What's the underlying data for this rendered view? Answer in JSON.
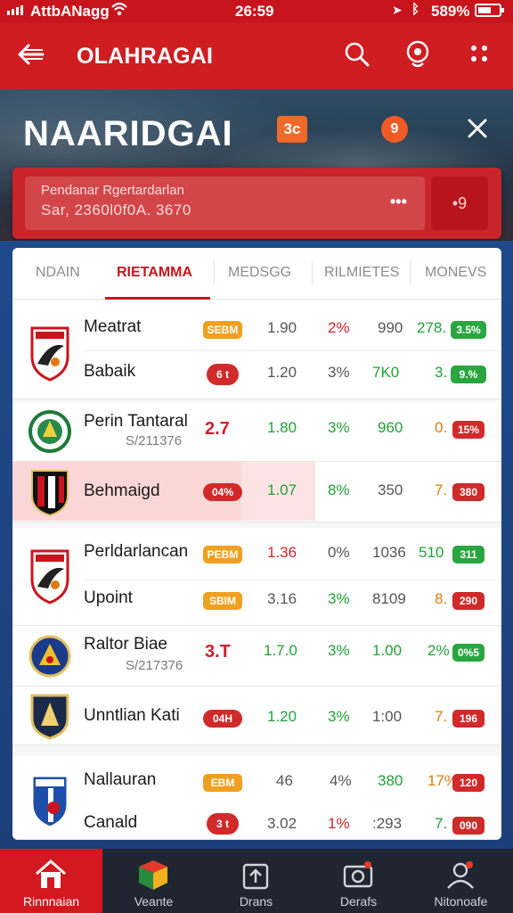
{
  "status": {
    "carrier": "AttbANagg",
    "time": "26:59",
    "battery": "589%"
  },
  "app_bar": {
    "title": "OLAHRAGAI",
    "icons": [
      "back-arrow-icon",
      "search-icon",
      "location-pin-icon",
      "more-dots-icon"
    ]
  },
  "hero": {
    "title": "NAARIDGAI",
    "badge": "3c",
    "round_badge": "9",
    "info_label": "Pendanar Rgertardarlan",
    "info_value": "Sar, 2360l0f0A. 3670",
    "dots": "•••",
    "side_value": "•9"
  },
  "tabs": [
    "NDAIN",
    "RIETAMMA",
    "MEDSGG",
    "RILMIETES",
    "MONEVS"
  ],
  "active_tab": 1,
  "colors": {
    "brand_red": "#cf1d22",
    "up_green": "#21a038",
    "down_red": "#d0202a",
    "pill_orange": "#f0a020"
  },
  "rows": [
    {
      "name": "Meatrat",
      "pill": "SEBM",
      "pill_color": "orange",
      "c1": "1.90",
      "c2": "2%",
      "c2_color": "red",
      "c3": "990",
      "c3_color": "plain",
      "c4": "278.",
      "c4_color": "green",
      "c5": "3.5%",
      "c5_color": "green"
    },
    {
      "name": "Babaik",
      "pill": "6 t",
      "pill_color": "red",
      "c1": "1.20",
      "c2": "3%",
      "c2_color": "plain",
      "c3": "7K0",
      "c3_color": "green",
      "c4": "3.",
      "c4_color": "green",
      "c5": "9.%",
      "c5_color": "green"
    },
    {
      "name": "Perin Tantaral",
      "sub": "S/211376",
      "pill": "2.7",
      "pill_color": "red",
      "c1": "1.80",
      "c1_color": "green",
      "c2": "3%",
      "c2_color": "green",
      "c3": "960",
      "c3_color": "green",
      "c4": "0.",
      "c4_color": "orange",
      "c5": "15%",
      "c5_color": "red"
    },
    {
      "name": "Behmaigd",
      "pill": "04%",
      "pill_color": "red",
      "c1": "1.07",
      "c1_color": "green",
      "c2": "8%",
      "c2_color": "green",
      "c3": "350",
      "c3_color": "plain",
      "c4": "7.",
      "c4_color": "orange",
      "c5": "380",
      "c5_color": "red"
    },
    {
      "name": "Perldarlancan",
      "pill": "PEBM",
      "pill_color": "orange",
      "c1": "1.36",
      "c1_color": "red",
      "c2": "0%",
      "c2_color": "plain",
      "c3": "1036",
      "c3_color": "plain",
      "c4": "510",
      "c4_color": "green",
      "c5": "311",
      "c5_color": "green"
    },
    {
      "name": "Upoint",
      "pill": "SBIM",
      "pill_color": "orange",
      "c1": "3.16",
      "c2": "3%",
      "c2_color": "green",
      "c3": "8109",
      "c3_color": "plain",
      "c4": "8.",
      "c4_color": "orange",
      "c5": "290",
      "c5_color": "red"
    },
    {
      "name": "Raltor Biae",
      "sub": "S/217376",
      "pill": "3.T",
      "pill_color": "red",
      "c1": "1.7.0",
      "c1_color": "green",
      "c2": "3%",
      "c2_color": "green",
      "c3": "1.00",
      "c3_color": "green",
      "c4": "2%",
      "c4_color": "green",
      "c5": "0%5",
      "c5_color": "green"
    },
    {
      "name": "Unntlian Kati",
      "pill": "04H",
      "pill_color": "red",
      "c1": "1.20",
      "c1_color": "green",
      "c2": "3%",
      "c2_color": "green",
      "c3": "1:00",
      "c3_color": "plain",
      "c4": "7.",
      "c4_color": "orange",
      "c5": "196",
      "c5_color": "red"
    },
    {
      "name": "Nallauran",
      "pill": "EBM",
      "pill_color": "orange",
      "c1": "46",
      "c2": "4%",
      "c2_color": "plain",
      "c3": "380",
      "c3_color": "green",
      "c4": "17%",
      "c4_color": "orange",
      "c5": "120",
      "c5_color": "red"
    },
    {
      "name": "Canald",
      "pill": "3 t",
      "pill_color": "red",
      "c1": "3.02",
      "c2": "1%",
      "c2_color": "red",
      "c3": ":293",
      "c3_color": "plain",
      "c4": "7.",
      "c4_color": "green",
      "c5": "090",
      "c5_color": "red"
    }
  ],
  "bottom_nav": [
    {
      "label": "Rinnnaian",
      "icon": "home-icon"
    },
    {
      "label": "Veante",
      "icon": "color-cube-icon"
    },
    {
      "label": "Drans",
      "icon": "upload-icon"
    },
    {
      "label": "Derafs",
      "icon": "camera-icon"
    },
    {
      "label": "Nitonoafe",
      "icon": "profile-icon"
    }
  ]
}
